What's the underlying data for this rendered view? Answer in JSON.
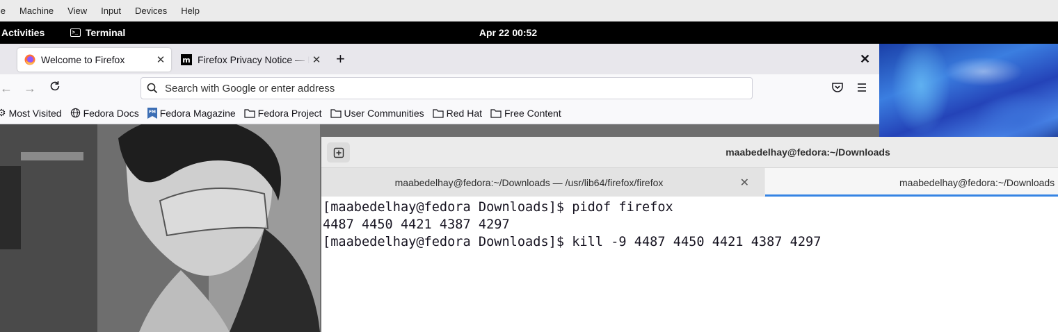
{
  "vbox_menu": [
    "ile",
    "Machine",
    "View",
    "Input",
    "Devices",
    "Help"
  ],
  "gnome": {
    "activities": "Activities",
    "app_name": "Terminal",
    "clock": "Apr 22  00:52"
  },
  "firefox": {
    "tabs": [
      {
        "label": "Welcome to Firefox"
      },
      {
        "label": "Firefox Privacy Notice — Mozilla"
      }
    ],
    "url_placeholder": "Search with Google or enter address",
    "bookmarks": [
      "Most Visited",
      "Fedora Docs",
      "Fedora Magazine",
      "Fedora Project",
      "User Communities",
      "Red Hat",
      "Free Content"
    ]
  },
  "terminal": {
    "title": "maabedelhay@fedora:~/Downloads",
    "tabs": [
      {
        "label": "maabedelhay@fedora:~/Downloads — /usr/lib64/firefox/firefox"
      },
      {
        "label": "maabedelhay@fedora:~/Downloads"
      }
    ],
    "lines": [
      "[maabedelhay@fedora Downloads]$ pidof firefox",
      "4487 4450 4421 4387 4297",
      "[maabedelhay@fedora Downloads]$ kill -9 4487 4450 4421 4387 4297"
    ]
  },
  "colors": {
    "accent": "#3584e4",
    "topbar": "#000000",
    "firefox_orange": "#ff7139"
  }
}
